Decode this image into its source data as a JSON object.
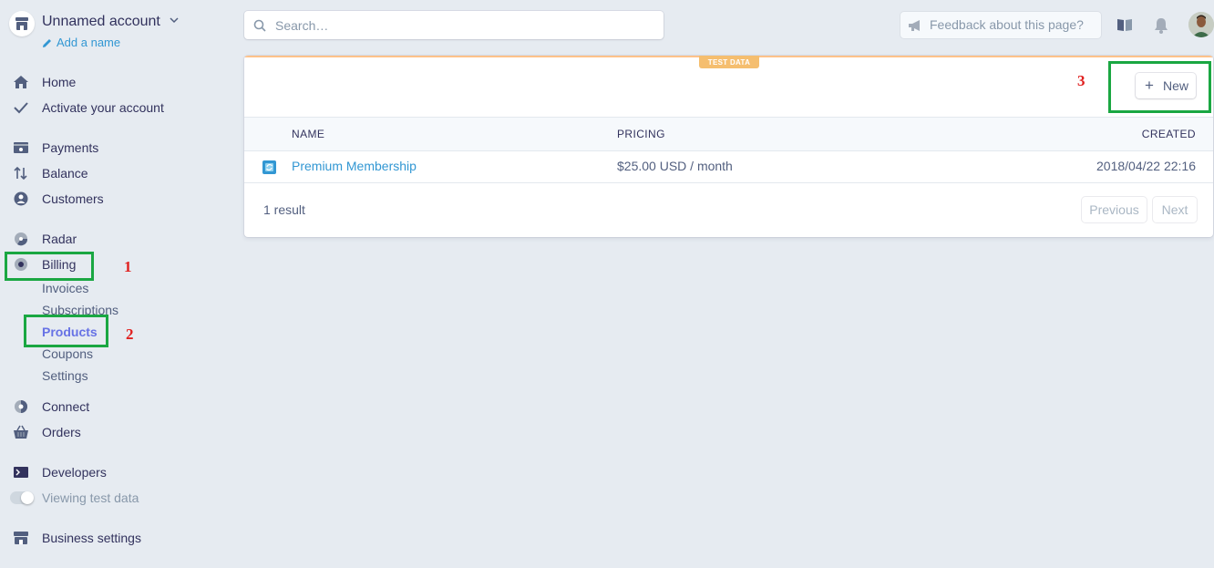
{
  "account": {
    "name": "Unnamed account",
    "add_name": "Add a name"
  },
  "nav": {
    "home": "Home",
    "activate": "Activate your account",
    "payments": "Payments",
    "balance": "Balance",
    "customers": "Customers",
    "radar": "Radar",
    "billing": "Billing",
    "billing_sub": {
      "invoices": "Invoices",
      "subscriptions": "Subscriptions",
      "products": "Products",
      "coupons": "Coupons",
      "settings": "Settings"
    },
    "connect": "Connect",
    "orders": "Orders",
    "developers": "Developers",
    "viewing_test_data": "Viewing test data",
    "business_settings": "Business settings"
  },
  "search": {
    "placeholder": "Search…"
  },
  "feedback": {
    "label": "Feedback about this page?"
  },
  "annotations": {
    "step1": "1",
    "step2": "2",
    "step3": "3"
  },
  "products_card": {
    "badge": "TEST DATA",
    "new_button": "New",
    "columns": {
      "name": "NAME",
      "pricing": "PRICING",
      "created": "CREATED"
    },
    "rows": [
      {
        "name": "Premium Membership",
        "pricing": "$25.00 USD / month",
        "created": "2018/04/22 22:16"
      }
    ],
    "result_count": "1 result",
    "previous": "Previous",
    "next": "Next"
  },
  "colors": {
    "accent": "#6772e5",
    "link": "#3297d3",
    "annotation_box": "#1aa742",
    "annotation_number": "#e0201f",
    "test_badge": "#f5be6f"
  }
}
